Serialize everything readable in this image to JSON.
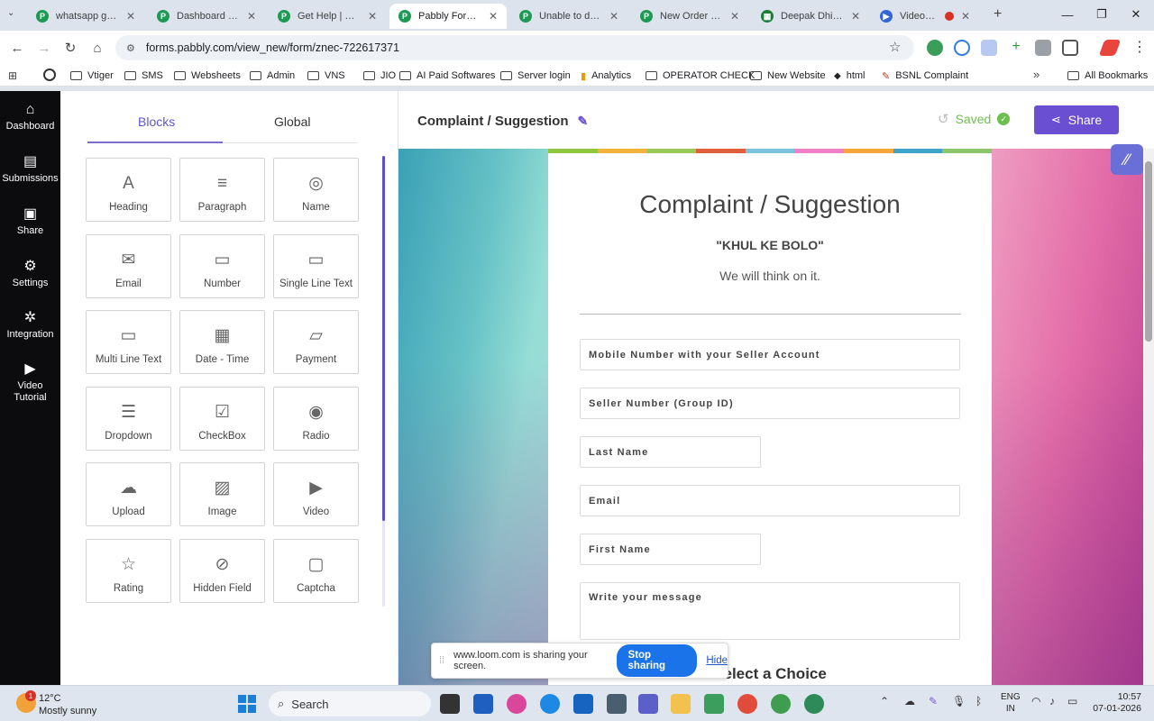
{
  "browser": {
    "tabs": [
      {
        "title": "whatsapp gpt | P",
        "fav_color": "#1f9a55",
        "active": false
      },
      {
        "title": "Dashboard | Pabb",
        "fav_color": "#1f9a55",
        "active": false
      },
      {
        "title": "Get Help | Pabbl",
        "fav_color": "#1f9a55",
        "active": false
      },
      {
        "title": "Pabbly Form Buil",
        "fav_color": "#1f9a55",
        "active": true
      },
      {
        "title": "Unable to delete",
        "fav_color": "#1f9a55",
        "active": false
      },
      {
        "title": "New Order | Pab",
        "fav_color": "#1f9a55",
        "active": false
      },
      {
        "title": "Deepak Dhingra",
        "fav_color": "#188038",
        "active": false
      },
      {
        "title": "Videos | Libr",
        "fav_color": "#3367d6",
        "active": false
      }
    ],
    "url": "forms.pabbly.com/view_new/form/znec-722617371",
    "bookmarks": [
      "Vtiger",
      "SMS",
      "Websheets",
      "Admin",
      "VNS",
      "JIO",
      "AI Paid Softwares",
      "Server login",
      "Analytics",
      "OPERATOR CHECK",
      "New Website",
      "html",
      "BSNL Complaint"
    ],
    "all_bookmarks": "All Bookmarks",
    "more_chevron": "»"
  },
  "left_nav": {
    "items": [
      {
        "label": "Dashboard",
        "icon": "⌂"
      },
      {
        "label": "Submissions",
        "icon": "▤"
      },
      {
        "label": "Share",
        "icon": "▣"
      },
      {
        "label": "Settings",
        "icon": "⚙"
      },
      {
        "label": "Integration",
        "icon": "✲"
      },
      {
        "label": "Video\nTutorial",
        "icon": "▶"
      }
    ]
  },
  "blocks_panel": {
    "tabs": [
      "Blocks",
      "Global"
    ],
    "blocks": [
      {
        "label": "Heading",
        "icon": "A"
      },
      {
        "label": "Paragraph",
        "icon": "≡"
      },
      {
        "label": "Name",
        "icon": "◎"
      },
      {
        "label": "Email",
        "icon": "✉"
      },
      {
        "label": "Number",
        "icon": "▭"
      },
      {
        "label": "Single Line Text",
        "icon": "▭"
      },
      {
        "label": "Multi Line Text",
        "icon": "▭"
      },
      {
        "label": "Date - Time",
        "icon": "▦"
      },
      {
        "label": "Payment",
        "icon": "▱"
      },
      {
        "label": "Dropdown",
        "icon": "☰"
      },
      {
        "label": "CheckBox",
        "icon": "☑"
      },
      {
        "label": "Radio",
        "icon": "◉"
      },
      {
        "label": "Upload",
        "icon": "☁"
      },
      {
        "label": "Image",
        "icon": "▨"
      },
      {
        "label": "Video",
        "icon": "▶"
      },
      {
        "label": "Rating",
        "icon": "☆"
      },
      {
        "label": "Hidden Field",
        "icon": "⊘"
      },
      {
        "label": "Captcha",
        "icon": "▢"
      }
    ]
  },
  "editor": {
    "form_title": "Complaint / Suggestion",
    "saved_label": "Saved",
    "share_label": "Share",
    "colorbar": [
      "#8fc73e",
      "#f2b33d",
      "#9cc85a",
      "#e0603e",
      "#7cc3e0",
      "#f081c8",
      "#f6a63a",
      "#3fa5c8",
      "#8cc56b"
    ]
  },
  "form": {
    "title": "Complaint / Suggestion",
    "subtitle": "\"KHUL KE BOLO\"",
    "description": "We will think on it.",
    "fields": [
      {
        "label": "Mobile Number with your Seller Account",
        "width": "full"
      },
      {
        "label": "Seller Number (Group ID)",
        "width": "full"
      },
      {
        "label": "Last Name",
        "width": "half"
      },
      {
        "label": "Email",
        "width": "full"
      },
      {
        "label": "First Name",
        "width": "half"
      },
      {
        "label": "Write your message",
        "width": "area"
      }
    ],
    "next_heading": "Select a Choice"
  },
  "loom": {
    "message": "www.loom.com is sharing your screen.",
    "stop_label": "Stop sharing",
    "hide_label": "Hide"
  },
  "taskbar": {
    "weather_temp": "12°C",
    "weather_desc": "Mostly sunny",
    "weather_badge": "1",
    "search_label": "Search",
    "lang_top": "ENG",
    "lang_bottom": "IN",
    "time": "10:57",
    "date": "07-01-2026"
  }
}
